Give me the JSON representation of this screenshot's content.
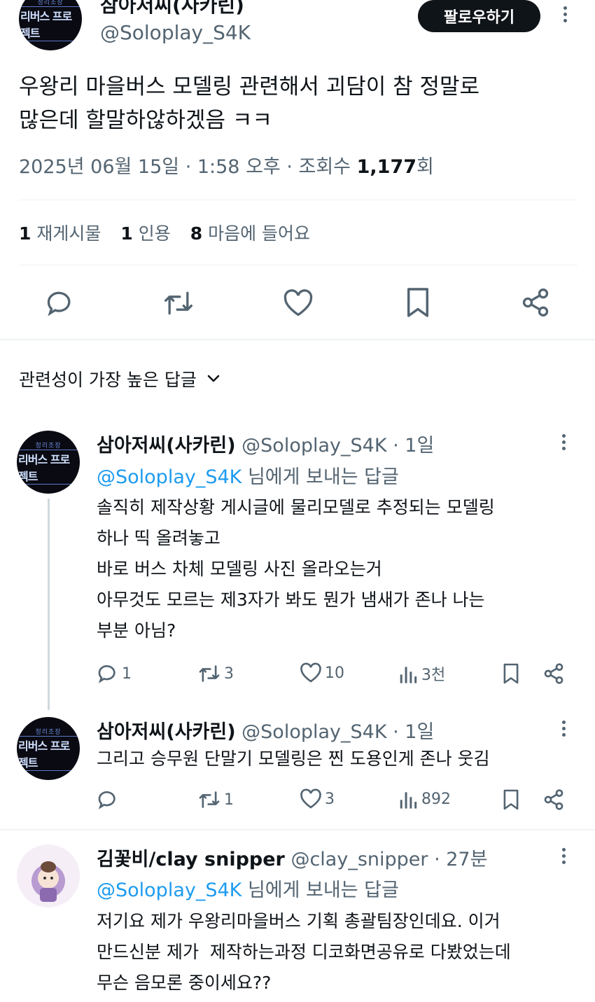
{
  "tweet": {
    "author_name": "삼아저씨(사카린)",
    "author_handle": "@Soloplay_S4K",
    "follow_label": "팔로우하기",
    "text_line1": "우왕리 마을버스 모델링 관련해서 괴담이 참 정말로",
    "text_line2": "많은데 할말하않하겠음 ㅋㅋ",
    "meta_date": "2025년 06월 15일 · 1:58 오후 · 조회수 ",
    "meta_views": "1,177",
    "meta_views_suffix": "회",
    "stats": {
      "reposts_count": "1",
      "reposts_label": "재게시물",
      "quotes_count": "1",
      "quotes_label": "인용",
      "likes_count": "8",
      "likes_label": "마음에 들어요"
    }
  },
  "sort": {
    "label": "관련성이 가장 높은 답글"
  },
  "avatar_logo": {
    "line1": "정리조장",
    "line2": "리버스 프로젝트"
  },
  "replies": [
    {
      "name": "삼아저씨(사카린)",
      "meta": "@Soloplay_S4K · 1일",
      "reply_to_handle": "@Soloplay_S4K",
      "reply_to_suffix": " 님에게 보내는 답글",
      "lines": [
        "솔직히 제작상황 게시글에 물리모델로 추정되는 모델링",
        "하나 띡 올려놓고",
        "바로 버스 차체 모델링 사진 올라오는거",
        "아무것도 모르는 제3자가 봐도 뭔가 냄새가 존나 나는",
        "부분 아님?"
      ],
      "replies": "1",
      "reposts": "3",
      "likes": "10",
      "views": "3천"
    },
    {
      "name": "삼아저씨(사카린)",
      "meta": "@Soloplay_S4K · 1일",
      "lines": [
        "그리고 승무원 단말기 모델링은 찐 도용인게 존나 웃김"
      ],
      "replies": "",
      "reposts": "1",
      "likes": "3",
      "views": "892"
    },
    {
      "name": "김꽃비/clay snipper",
      "meta": "@clay_snipper · 27분",
      "reply_to_handle": "@Soloplay_S4K",
      "reply_to_suffix": " 님에게 보내는 답글",
      "lines": [
        "저기요 제가 우왕리마을버스 기획 총괄팀장인데요. 이거",
        "만드신분 제가  제작하는과정 디코화면공유로 다봤었는데",
        "무슨 음모론 중이세요??"
      ]
    }
  ],
  "colors": {
    "text": "#0f1419",
    "secondary": "#536471",
    "accent": "#1d9bf0",
    "divider": "#eff3f4"
  }
}
